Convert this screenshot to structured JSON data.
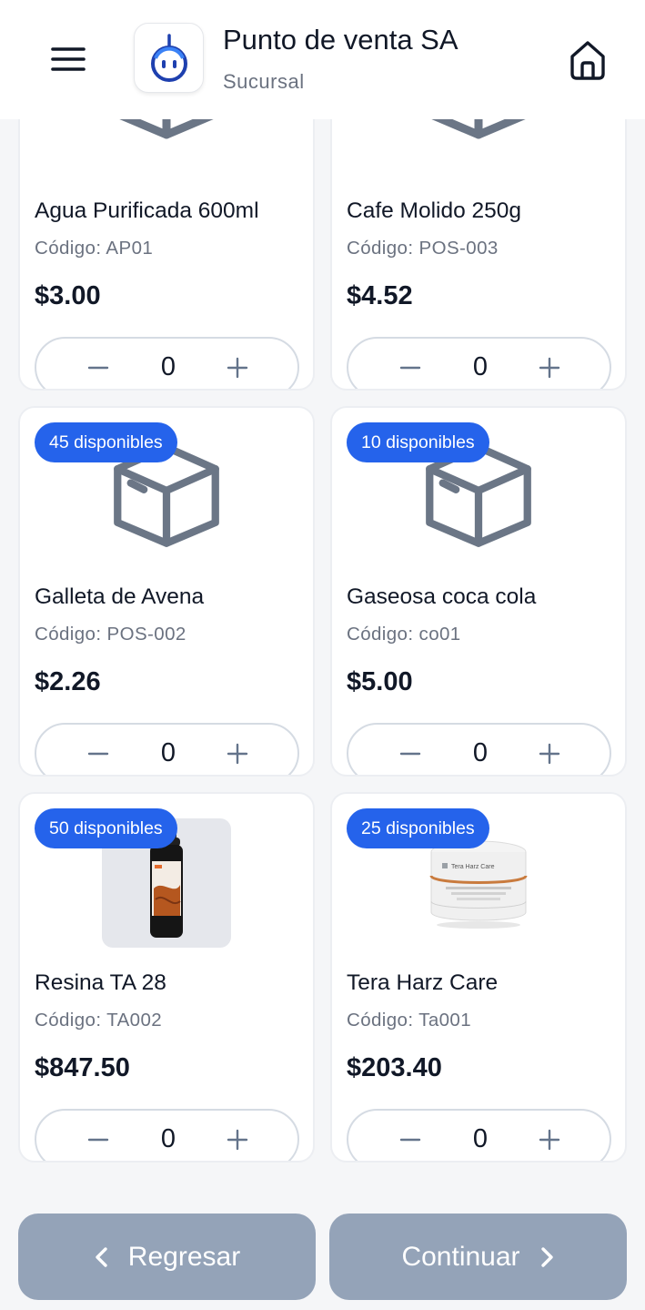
{
  "header": {
    "title": "Punto de venta SA",
    "subtitle": "Sucursal",
    "icons": {
      "menu": "menu-icon",
      "logo": "robot-logo",
      "home": "home-icon"
    }
  },
  "colors": {
    "accent": "#2563eb",
    "disabled_button": "#94a3b8",
    "muted_text": "#6b7280"
  },
  "products": [
    {
      "name": "Agua Purificada 600ml",
      "code": "Código: AP01",
      "price": "$3.00",
      "quantity": "0",
      "badge": "",
      "image": "box-icon"
    },
    {
      "name": "Cafe Molido 250g",
      "code": "Código: POS-003",
      "price": "$4.52",
      "quantity": "0",
      "badge": "",
      "image": "box-icon"
    },
    {
      "name": "Galleta de Avena",
      "code": "Código: POS-002",
      "price": "$2.26",
      "quantity": "0",
      "badge": "45 disponibles",
      "image": "box-icon"
    },
    {
      "name": "Gaseosa coca cola",
      "code": "Código: co01",
      "price": "$5.00",
      "quantity": "0",
      "badge": "10 disponibles",
      "image": "box-icon"
    },
    {
      "name": "Resina TA 28",
      "code": "Código: TA002",
      "price": "$847.50",
      "quantity": "0",
      "badge": "50 disponibles",
      "image": "resin-bottle-photo"
    },
    {
      "name": "Tera Harz Care",
      "code": "Código: Ta001",
      "price": "$203.40",
      "quantity": "0",
      "badge": "25 disponibles",
      "image": "cleaner-jar-photo",
      "label_on_product": "Tera Harz Care"
    }
  ],
  "footer": {
    "back_label": "Regresar",
    "next_label": "Continuar"
  }
}
